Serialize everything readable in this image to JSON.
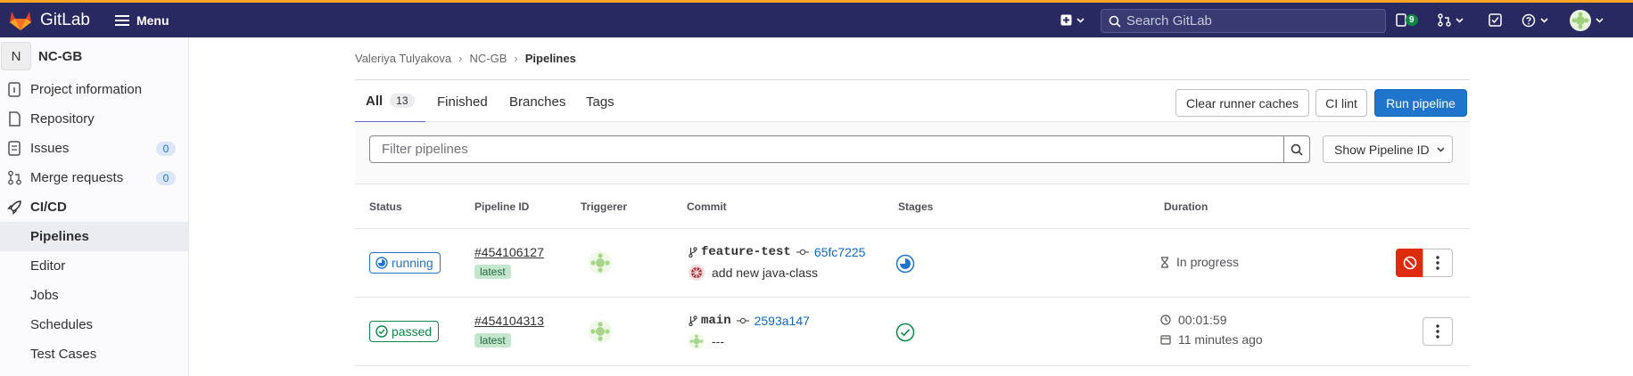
{
  "navbar": {
    "brand": "GitLab",
    "menu_label": "Menu",
    "search_placeholder": "Search GitLab",
    "issues_count": "9"
  },
  "sidebar": {
    "project_initial": "N",
    "project_name": "NC-GB",
    "items": [
      {
        "label": "Project information",
        "icon": "info-icon"
      },
      {
        "label": "Repository",
        "icon": "doc-icon"
      },
      {
        "label": "Issues",
        "icon": "issues-icon",
        "count": "0"
      },
      {
        "label": "Merge requests",
        "icon": "merge-request-icon",
        "count": "0"
      },
      {
        "label": "CI/CD",
        "icon": "rocket-icon"
      },
      {
        "label": "Pipelines"
      },
      {
        "label": "Editor"
      },
      {
        "label": "Jobs"
      },
      {
        "label": "Schedules"
      },
      {
        "label": "Test Cases"
      }
    ]
  },
  "breadcrumb": [
    "Valeriya Tulyakova",
    "NC-GB",
    "Pipelines"
  ],
  "tabs": [
    {
      "label": "All",
      "count": "13"
    },
    {
      "label": "Finished"
    },
    {
      "label": "Branches"
    },
    {
      "label": "Tags"
    }
  ],
  "actions": {
    "clear_caches": "Clear runner caches",
    "ci_lint": "CI lint",
    "run_pipeline": "Run pipeline"
  },
  "filter": {
    "placeholder": "Filter pipelines",
    "show_id": "Show Pipeline ID"
  },
  "table": {
    "headers": [
      "Status",
      "Pipeline ID",
      "Triggerer",
      "Commit",
      "Stages",
      "Duration"
    ],
    "rows": [
      {
        "status": "running",
        "pipeline_id": "#454106127",
        "tag": "latest",
        "branch": "feature-test",
        "sha": "65fc7225",
        "message": "add new java-class",
        "duration": "In progress"
      },
      {
        "status": "passed",
        "pipeline_id": "#454104313",
        "tag": "latest",
        "branch": "main",
        "sha": "2593a147",
        "message": "---",
        "duration": "00:01:59",
        "finished": "11 minutes ago"
      }
    ]
  },
  "colors": {
    "navbar": "#292961",
    "primary": "#1f75cb",
    "running": "#1f75cb",
    "passed": "#108548",
    "cancel": "#dd2b0e"
  }
}
